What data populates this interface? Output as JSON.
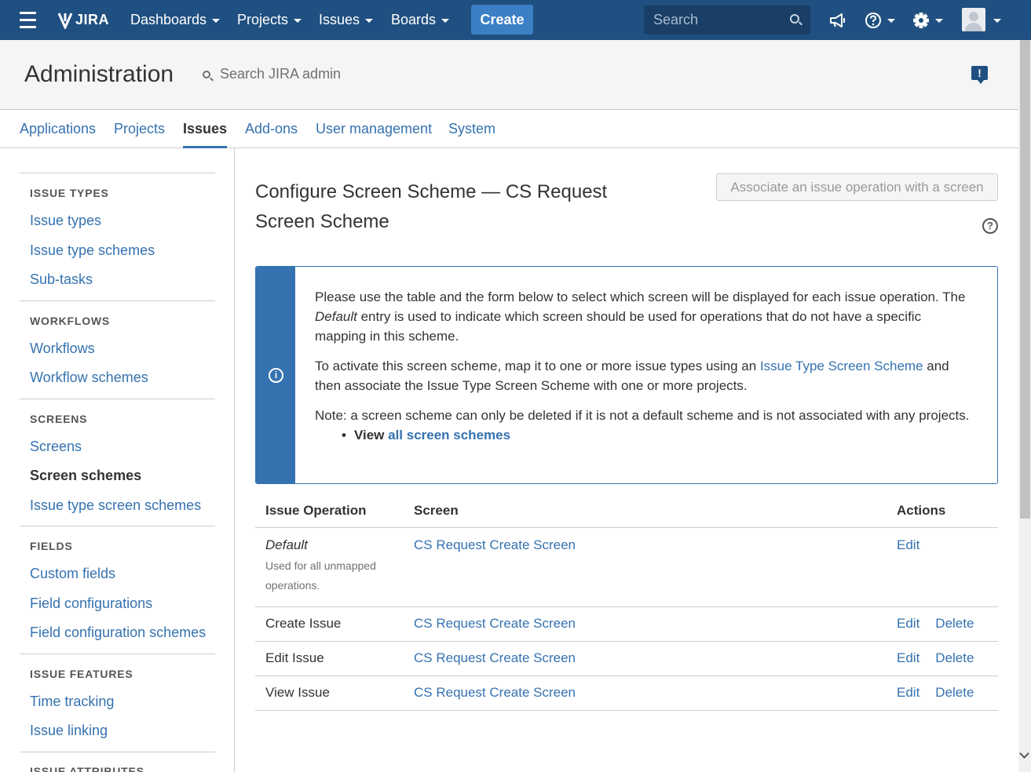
{
  "topnav": {
    "logo": "JIRA",
    "dashboards": "Dashboards",
    "projects": "Projects",
    "issues": "Issues",
    "boards": "Boards",
    "create": "Create",
    "search_placeholder": "Search"
  },
  "admin": {
    "title": "Administration",
    "search_label": "Search JIRA admin",
    "feedback_glyph": "!"
  },
  "tabs": [
    "Applications",
    "Projects",
    "Issues",
    "Add-ons",
    "User management",
    "System"
  ],
  "sidebar": {
    "issue_types_heading": "ISSUE TYPES",
    "issue_types": "Issue types",
    "issue_type_schemes": "Issue type schemes",
    "sub_tasks": "Sub-tasks",
    "workflows_heading": "WORKFLOWS",
    "workflows": "Workflows",
    "workflow_schemes": "Workflow schemes",
    "screens_heading": "SCREENS",
    "screens": "Screens",
    "screen_schemes": "Screen schemes",
    "issue_type_screen_schemes": "Issue type screen schemes",
    "fields_heading": "FIELDS",
    "custom_fields": "Custom fields",
    "field_configurations": "Field configurations",
    "field_configuration_schemes": "Field configuration schemes",
    "issue_features_heading": "ISSUE FEATURES",
    "time_tracking": "Time tracking",
    "issue_linking": "Issue linking",
    "issue_attributes_heading": "ISSUE ATTRIBUTES"
  },
  "main": {
    "title": "Configure Screen Scheme — CS Request Screen Scheme",
    "associate_button": "Associate an issue operation with a screen",
    "help_glyph": "?",
    "info": {
      "p1_a": "Please use the table and the form below to select which screen will be displayed for each issue operation. The ",
      "p1_em": "Default",
      "p1_b": " entry is used to indicate which screen should be used for operations that do not have a specific mapping in this scheme.",
      "p2_a": "To activate this screen scheme, map it to one or more issue types using an ",
      "p2_link": "Issue Type Screen Scheme",
      "p2_b": " and then associate the Issue Type Screen Scheme with one or more projects.",
      "p3": "Note: a screen scheme can only be deleted if it is not a default scheme and is not associated with any projects.",
      "view_label": "View ",
      "view_link": "all screen schemes"
    },
    "table": {
      "headers": [
        "Issue Operation",
        "Screen",
        "Actions"
      ],
      "default_row": {
        "operation": "Default",
        "description": "Used for all unmapped operations.",
        "screen": "CS Request Create Screen",
        "edit": "Edit"
      },
      "rows": [
        {
          "operation": "Create Issue",
          "screen": "CS Request Create Screen",
          "edit": "Edit",
          "delete": "Delete"
        },
        {
          "operation": "Edit Issue",
          "screen": "CS Request Create Screen",
          "edit": "Edit",
          "delete": "Delete"
        },
        {
          "operation": "View Issue",
          "screen": "CS Request Create Screen",
          "edit": "Edit",
          "delete": "Delete"
        }
      ]
    }
  }
}
